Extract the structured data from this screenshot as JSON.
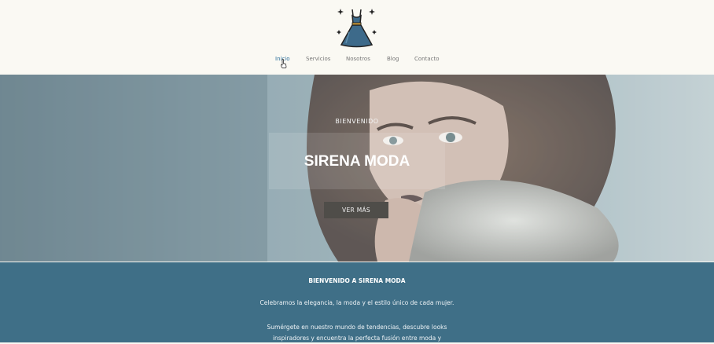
{
  "nav": {
    "items": [
      "Inicio",
      "Servicios",
      "Nosotros",
      "Blog",
      "Contacto"
    ],
    "active": "Inicio"
  },
  "hero": {
    "welcome": "BIENVENIDO",
    "title": "SIRENA MODA",
    "button": "VER MÁS"
  },
  "about": {
    "title": "BIENVENIDO A SIRENA MODA",
    "p1": "Celebramos la elegancia, la moda y el estilo único de cada mujer.",
    "p2_line1": "Sumérgete en nuestro mundo de tendencias, descubre looks",
    "p2_line2": "inspiradores y encuentra la perfecta fusión entre moda y"
  },
  "colors": {
    "header_bg": "#faf9f3",
    "nav_active": "#2b6f9b",
    "band_bg": "#3f6f87",
    "button_bg": "#4f4d49"
  },
  "icons": {
    "logo": "dress-logo-icon",
    "cursor": "hand-pointer-cursor-icon"
  }
}
